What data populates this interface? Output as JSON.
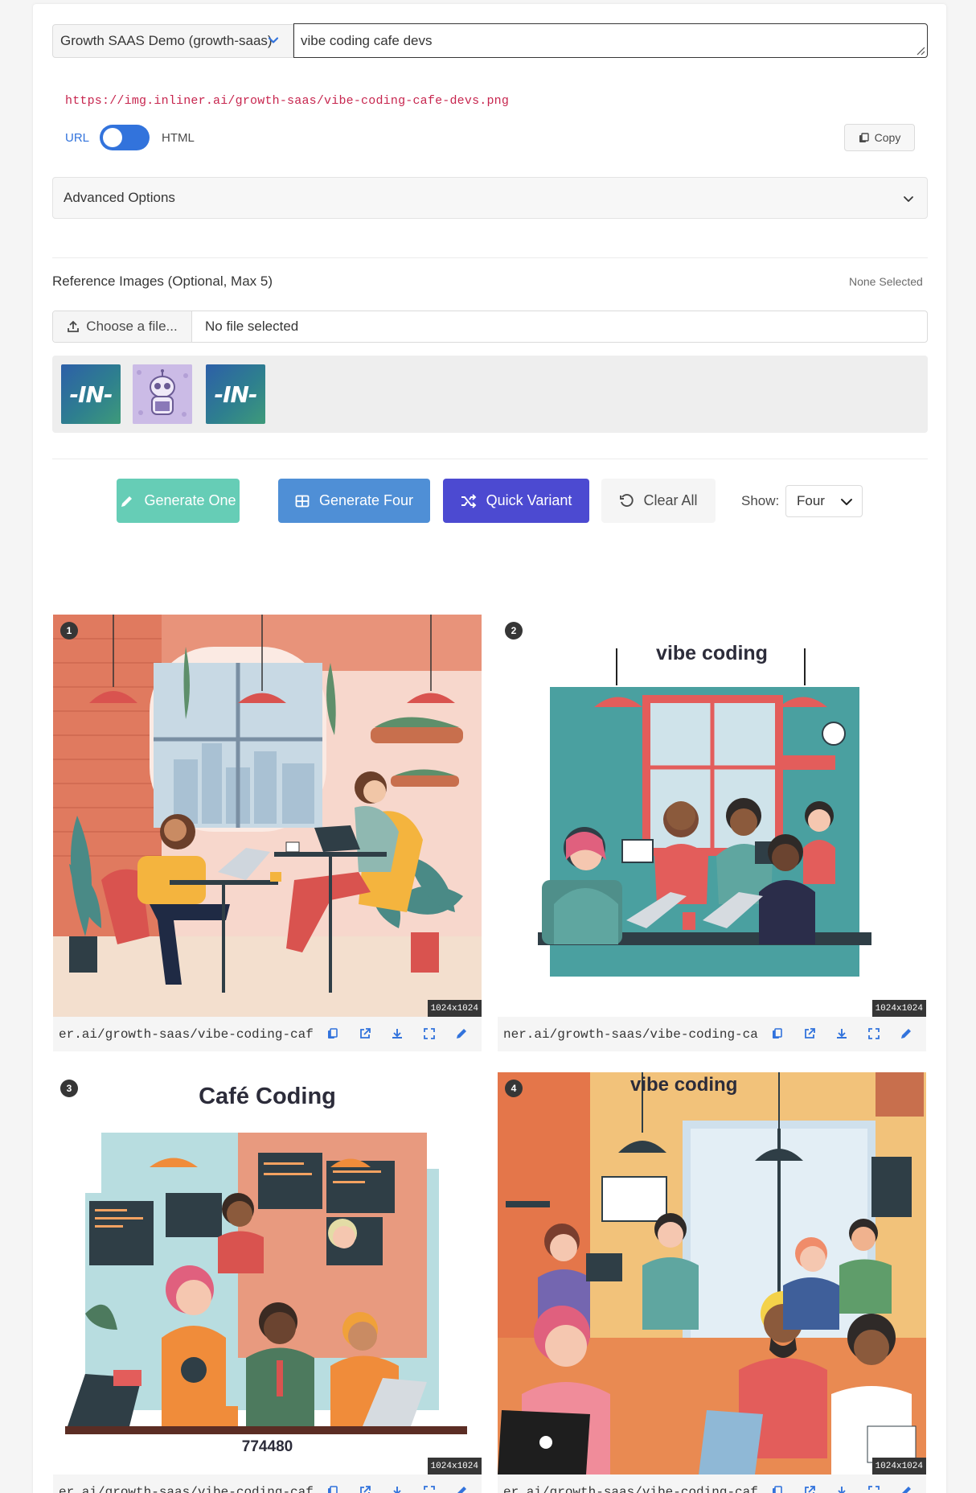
{
  "project_select": {
    "value": "Growth SAAS Demo (growth-saas)"
  },
  "prompt": {
    "value": "vibe coding cafe devs"
  },
  "output": {
    "url": "https://img.inliner.ai/growth-saas/vibe-coding-cafe-devs.png",
    "toggle_left": "URL",
    "toggle_right": "HTML",
    "copy_label": "Copy"
  },
  "advanced": {
    "label": "Advanced Options"
  },
  "reference": {
    "title": "Reference Images (Optional, Max 5)",
    "status": "None Selected",
    "choose_label": "Choose a file...",
    "file_name": "No file selected",
    "thumbnails": [
      {
        "kind": "logo",
        "text": "-IN-"
      },
      {
        "kind": "robot-illustration"
      },
      {
        "kind": "logo",
        "text": "-IN-"
      }
    ]
  },
  "actions": {
    "generate_one": "Generate One",
    "generate_four": "Generate Four",
    "quick_variant": "Quick Variant",
    "clear_all": "Clear All",
    "show_label": "Show:",
    "show_value": "Four"
  },
  "results": [
    {
      "index": "1",
      "dims": "1024x1024",
      "link": "er.ai/growth-saas/vibe-coding-caf",
      "caption": "",
      "caption2": ""
    },
    {
      "index": "2",
      "dims": "1024x1024",
      "link": "ner.ai/growth-saas/vibe-coding-ca",
      "caption": "vibe coding",
      "caption2": ""
    },
    {
      "index": "3",
      "dims": "1024x1024",
      "link": "er.ai/growth-saas/vibe-coding-caf",
      "caption": "Café Coding",
      "caption2": "774480"
    },
    {
      "index": "4",
      "dims": "1024x1024",
      "link": "er.ai/growth-saas/vibe-coding-caf",
      "caption": "vibe coding",
      "caption2": ""
    }
  ],
  "colors": {
    "primary": "#3273dc",
    "teal": "#66cdb6",
    "blue": "#4f8fd6",
    "purple": "#4c4ad1",
    "url_code": "#c7254e"
  }
}
